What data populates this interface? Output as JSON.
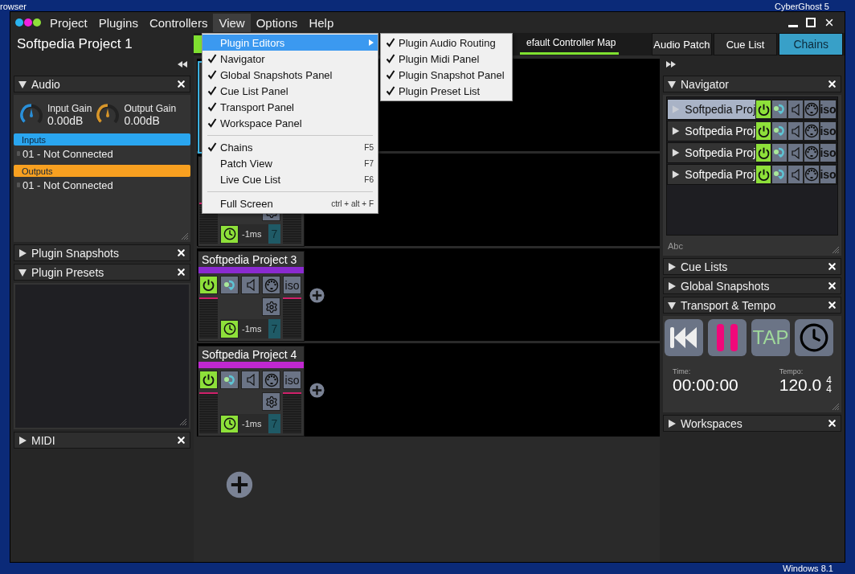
{
  "desktop": {
    "top_left": "rowser",
    "top_right": "CyberGhost 5",
    "bottom_right": "Windows 8.1"
  },
  "menubar": {
    "items": [
      {
        "label": "Project",
        "selected": false
      },
      {
        "label": "Plugins",
        "selected": false
      },
      {
        "label": "Controllers",
        "selected": false
      },
      {
        "label": "View",
        "selected": true
      },
      {
        "label": "Options",
        "selected": false
      },
      {
        "label": "Help",
        "selected": false
      }
    ]
  },
  "project_title": "Softpedia Project 1",
  "center_tabs": [
    {
      "label": "efault Controller Map",
      "selected": true
    }
  ],
  "view_tabs": [
    {
      "label": "Audio Patch",
      "selected": false
    },
    {
      "label": "Cue List",
      "selected": false
    },
    {
      "label": "Chains",
      "selected": true
    }
  ],
  "left_panels": [
    {
      "kind": "audio",
      "title": "Audio",
      "expanded": true,
      "knobs": [
        {
          "label": "Input Gain",
          "value": "0.00dB",
          "color": "#2a8fd8"
        },
        {
          "label": "Output Gain",
          "value": "0.00dB",
          "color": "#d8962a"
        }
      ],
      "sections": [
        {
          "label": "Inputs",
          "color": "#2aa6f0",
          "rows": [
            "01 - Not Connected"
          ]
        },
        {
          "label": "Outputs",
          "color": "#f8a020",
          "rows": [
            "01 - Not Connected"
          ]
        }
      ]
    },
    {
      "title": "Plugin Snapshots",
      "expanded": false
    },
    {
      "kind": "list",
      "title": "Plugin Presets",
      "expanded": true
    },
    {
      "title": "MIDI",
      "expanded": false
    }
  ],
  "chains": [
    {
      "kind": "covered",
      "selected": true
    },
    {
      "kind": "lower",
      "selected": false,
      "latency": "-1ms",
      "channel": "7"
    },
    {
      "kind": "full",
      "name": "Softpedia Project 3",
      "color": "#8a2ad0",
      "selected": false,
      "power": true,
      "iso": "iso",
      "latency": "-1ms",
      "channel": "7"
    },
    {
      "kind": "full",
      "name": "Softpedia Project 4",
      "color": "#c028d0",
      "selected": false,
      "power": true,
      "iso": "iso",
      "latency": "-1ms",
      "channel": "7"
    }
  ],
  "right_panels": [
    {
      "kind": "navigator",
      "title": "Navigator",
      "expanded": true,
      "placeholder": "Abc",
      "rows": [
        {
          "name": "Softpedia Proj",
          "selected": true,
          "power": true,
          "iso": "iso"
        },
        {
          "name": "Softpedia Proj",
          "selected": false,
          "power": true,
          "iso": "iso"
        },
        {
          "name": "Softpedia Proj",
          "selected": false,
          "power": true,
          "iso": "iso"
        },
        {
          "name": "Softpedia Proj",
          "selected": false,
          "power": true,
          "iso": "iso"
        }
      ]
    },
    {
      "title": "Cue Lists",
      "expanded": false
    },
    {
      "title": "Global Snapshots",
      "expanded": false
    },
    {
      "kind": "transport",
      "title": "Transport & Tempo",
      "expanded": true,
      "tap": "TAP",
      "time_label": "Time:",
      "time": "00:00:00",
      "tempo_label": "Tempo:",
      "tempo": "120.0",
      "signature": [
        "4",
        "4"
      ]
    },
    {
      "title": "Workspaces",
      "expanded": false
    }
  ],
  "menu": {
    "items": [
      {
        "kind": "submenu",
        "label": "Plugin Editors",
        "selected": true
      },
      {
        "kind": "item",
        "label": "Navigator",
        "checked": true
      },
      {
        "kind": "item",
        "label": "Global Snapshots Panel",
        "checked": true
      },
      {
        "kind": "item",
        "label": "Cue List Panel",
        "checked": true
      },
      {
        "kind": "item",
        "label": "Transport Panel",
        "checked": true
      },
      {
        "kind": "item",
        "label": "Workspace Panel",
        "checked": true
      },
      {
        "kind": "separator"
      },
      {
        "kind": "item",
        "label": "Chains",
        "checked": true,
        "shortcut": "F5"
      },
      {
        "kind": "item",
        "label": "Patch View",
        "checked": false,
        "shortcut": "F7"
      },
      {
        "kind": "item",
        "label": "Live Cue List",
        "checked": false,
        "shortcut": "F6"
      },
      {
        "kind": "separator"
      },
      {
        "kind": "item",
        "label": "Full Screen",
        "checked": false,
        "shortcut": "ctrl + alt + F"
      }
    ]
  },
  "submenu": {
    "items": [
      {
        "label": "Plugin Audio Routing",
        "checked": true
      },
      {
        "label": "Plugin Midi Panel",
        "checked": true
      },
      {
        "label": "Plugin Snapshot Panel",
        "checked": true
      },
      {
        "label": "Plugin Preset List",
        "checked": true
      }
    ]
  }
}
